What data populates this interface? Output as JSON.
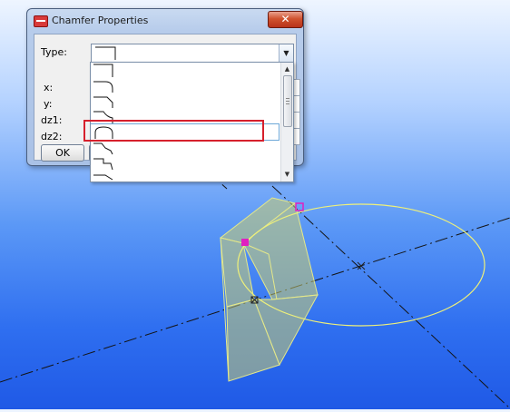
{
  "dialog": {
    "title": "Chamfer Properties",
    "close_symbol": "✕",
    "type_label": "Type:",
    "x_label": "x:",
    "y_label": "y:",
    "dz1_label": "dz1:",
    "dz2_label": "dz2:",
    "ok_label": "OK"
  },
  "dropdown": {
    "option_icons": [
      "corner-square-icon",
      "corner-round-icon",
      "corner-chamfer-icon",
      "corner-hook-icon",
      "corner-arc-icon",
      "corner-zigzag-icon",
      "corner-step-icon",
      "corner-angle-icon"
    ],
    "selected_index": 4,
    "highlight_color": "#d6202c"
  },
  "scene": {
    "selection_color": "#f0f06a",
    "handle_color": "#e020c0"
  }
}
